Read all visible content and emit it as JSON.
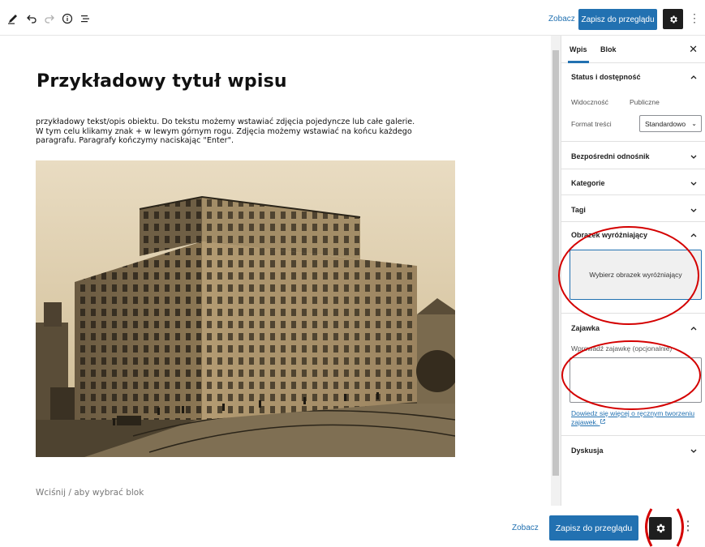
{
  "toolbar": {
    "icons": [
      "pencil-icon",
      "undo-icon",
      "redo-icon",
      "info-icon",
      "list-view-icon"
    ],
    "preview_label": "Zobacz",
    "submit_label": "Zapisz do przeglądu"
  },
  "editor": {
    "title": "Przykładowy tytuł wpisu",
    "paragraph_lines": [
      "przykładowy tekst/opis obiektu. Do tekstu możemy wstawiać zdjęcia pojedyncze lub całe galerie.",
      "W tym celu klikamy znak + w lewym górnym rogu. Zdjęcia możemy wstawiać na końcu każdego",
      "paragrafu. Paragrafy kończymy naciskając \"Enter\"."
    ],
    "block_placeholder": "Wciśnij / aby wybrać blok"
  },
  "sidebar": {
    "tabs": [
      "Wpis",
      "Blok"
    ],
    "status": {
      "title": "Status i dostępność",
      "visibility_label": "Widoczność",
      "visibility_value": "Publiczne",
      "format_label": "Format treści",
      "format_value": "Standardowo"
    },
    "panels": {
      "permalink": "Bezpośredni odnośnik",
      "categories": "Kategorie",
      "tags": "Tagi",
      "featured_image": "Obrazek wyróżniający",
      "excerpt": "Zajawka",
      "discussion": "Dyskusja"
    },
    "featured_image_button": "Wybierz obrazek wyróżniający",
    "excerpt_label": "Wprowadź zajawkę (opcjonalnie)",
    "excerpt_value": "",
    "excerpt_link_lines": [
      "Dowiedz się więcej o ręcznym tworzeniu",
      "zajawek."
    ]
  },
  "bottom_bar": {
    "preview_label": "Zobacz",
    "submit_label": "Zapisz do przeglądu"
  },
  "colors": {
    "accent": "#2271b1",
    "annotation": "#d40000",
    "dark_button": "#1e1e1e"
  }
}
